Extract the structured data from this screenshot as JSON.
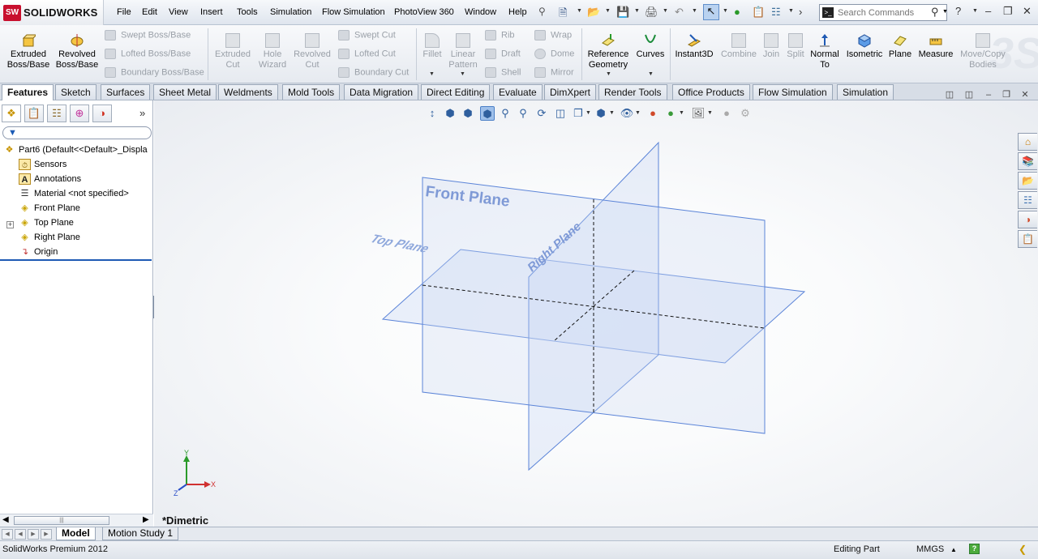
{
  "app": {
    "logo_mark": "SW",
    "logo_text": "SOLIDWORKS"
  },
  "menu": [
    "File",
    "Edit",
    "View",
    "Insert",
    "Tools",
    "Simulation",
    "Flow Simulation",
    "PhotoView 360",
    "Window",
    "Help"
  ],
  "search": {
    "placeholder": "Search Commands"
  },
  "commands": {
    "extruded_boss": "Extruded Boss/Base",
    "revolved_boss": "Revolved Boss/Base",
    "swept_boss": "Swept Boss/Base",
    "lofted_boss": "Lofted Boss/Base",
    "boundary_boss": "Boundary Boss/Base",
    "extruded_cut": "Extruded Cut",
    "hole_wizard": "Hole Wizard",
    "revolved_cut": "Revolved Cut",
    "swept_cut": "Swept Cut",
    "lofted_cut": "Lofted Cut",
    "boundary_cut": "Boundary Cut",
    "fillet": "Fillet",
    "linear_pattern": "Linear Pattern",
    "rib": "Rib",
    "draft": "Draft",
    "shell": "Shell",
    "wrap": "Wrap",
    "dome": "Dome",
    "mirror": "Mirror",
    "reference_geometry": "Reference Geometry",
    "curves": "Curves",
    "instant3d": "Instant3D",
    "combine": "Combine",
    "join": "Join",
    "split": "Split",
    "normal_to": "Normal To",
    "isometric": "Isometric",
    "plane": "Plane",
    "measure": "Measure",
    "move_copy": "Move/Copy Bodies"
  },
  "tabs": [
    "Features",
    "Sketch",
    "Surfaces",
    "Sheet Metal",
    "Weldments",
    "Mold Tools",
    "Data Migration",
    "Direct Editing",
    "Evaluate",
    "DimXpert",
    "Render Tools",
    "Office Products",
    "Flow Simulation",
    "Simulation"
  ],
  "tree": {
    "part": "Part6  (Default<<Default>_Displa",
    "items": [
      "Sensors",
      "Annotations",
      "Material <not specified>",
      "Front Plane",
      "Top Plane",
      "Right Plane",
      "Origin"
    ]
  },
  "viewport": {
    "front_plane_label": "Front Plane",
    "top_plane_label": "Top Plane",
    "right_plane_label": "Right Plane",
    "view_name": "*Dimetric",
    "triad_x": "X",
    "triad_y": "Y",
    "triad_z": "Z"
  },
  "bottom_tabs": [
    "Model",
    "Motion Study 1"
  ],
  "status": {
    "product": "SolidWorks Premium 2012",
    "mode": "Editing Part",
    "units": "MMGS",
    "help": "?"
  },
  "colors": {
    "accent_blue": "#1f5ab4",
    "plane_edge": "#5b84d8",
    "plane_fill": "#c9d7f3",
    "plane_label": "#7f9ad6"
  }
}
